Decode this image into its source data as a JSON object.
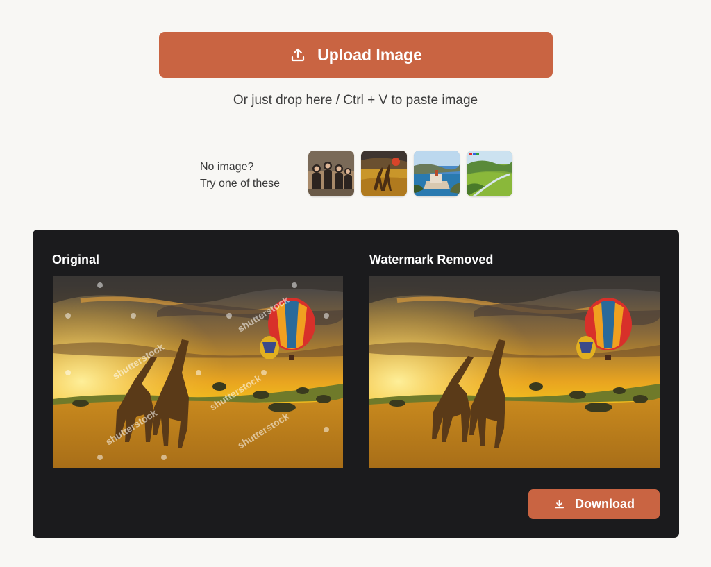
{
  "upload": {
    "button_label": "Upload Image",
    "icon": "upload-icon",
    "hint": "Or just drop here / Ctrl + V to paste image"
  },
  "samples": {
    "label_line1": "No image?",
    "label_line2": "Try one of these",
    "thumbnails": [
      "group-photo",
      "giraffe-savanna",
      "coastal-castle",
      "green-valley"
    ]
  },
  "result": {
    "original_label": "Original",
    "removed_label": "Watermark Removed",
    "watermark_text": "shutterstock",
    "download_label": "Download",
    "download_icon": "download-icon"
  },
  "colors": {
    "accent": "#c96442",
    "background": "#f8f7f4",
    "panel": "#1b1b1d"
  }
}
